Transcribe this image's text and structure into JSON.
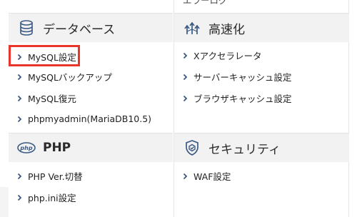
{
  "left_column": {
    "database": {
      "title": "データベース",
      "icon": "database-icon",
      "items": [
        {
          "label": "MySQL設定",
          "highlighted": true
        },
        {
          "label": "MySQLバックアップ"
        },
        {
          "label": "MySQL復元"
        },
        {
          "label": "phpmyadmin(MariaDB10.5)"
        }
      ]
    },
    "php": {
      "title": "PHP",
      "icon": "php-icon",
      "items": [
        {
          "label": "PHP Ver.切替"
        },
        {
          "label": "php.ini設定"
        }
      ]
    }
  },
  "right_column": {
    "top_partial": "エラーログ",
    "speed": {
      "title": "高速化",
      "icon": "speed-arrows-icon",
      "items": [
        {
          "label": "Xアクセラレータ"
        },
        {
          "label": "サーバーキャッシュ設定"
        },
        {
          "label": "ブラウザキャッシュ設定"
        }
      ]
    },
    "security": {
      "title": "セキュリティ",
      "icon": "shield-icon",
      "items": [
        {
          "label": "WAF設定"
        }
      ]
    }
  },
  "colors": {
    "accent": "#3a5a85",
    "highlight": "#e8362a",
    "header_bg": "#f2f2f2"
  }
}
